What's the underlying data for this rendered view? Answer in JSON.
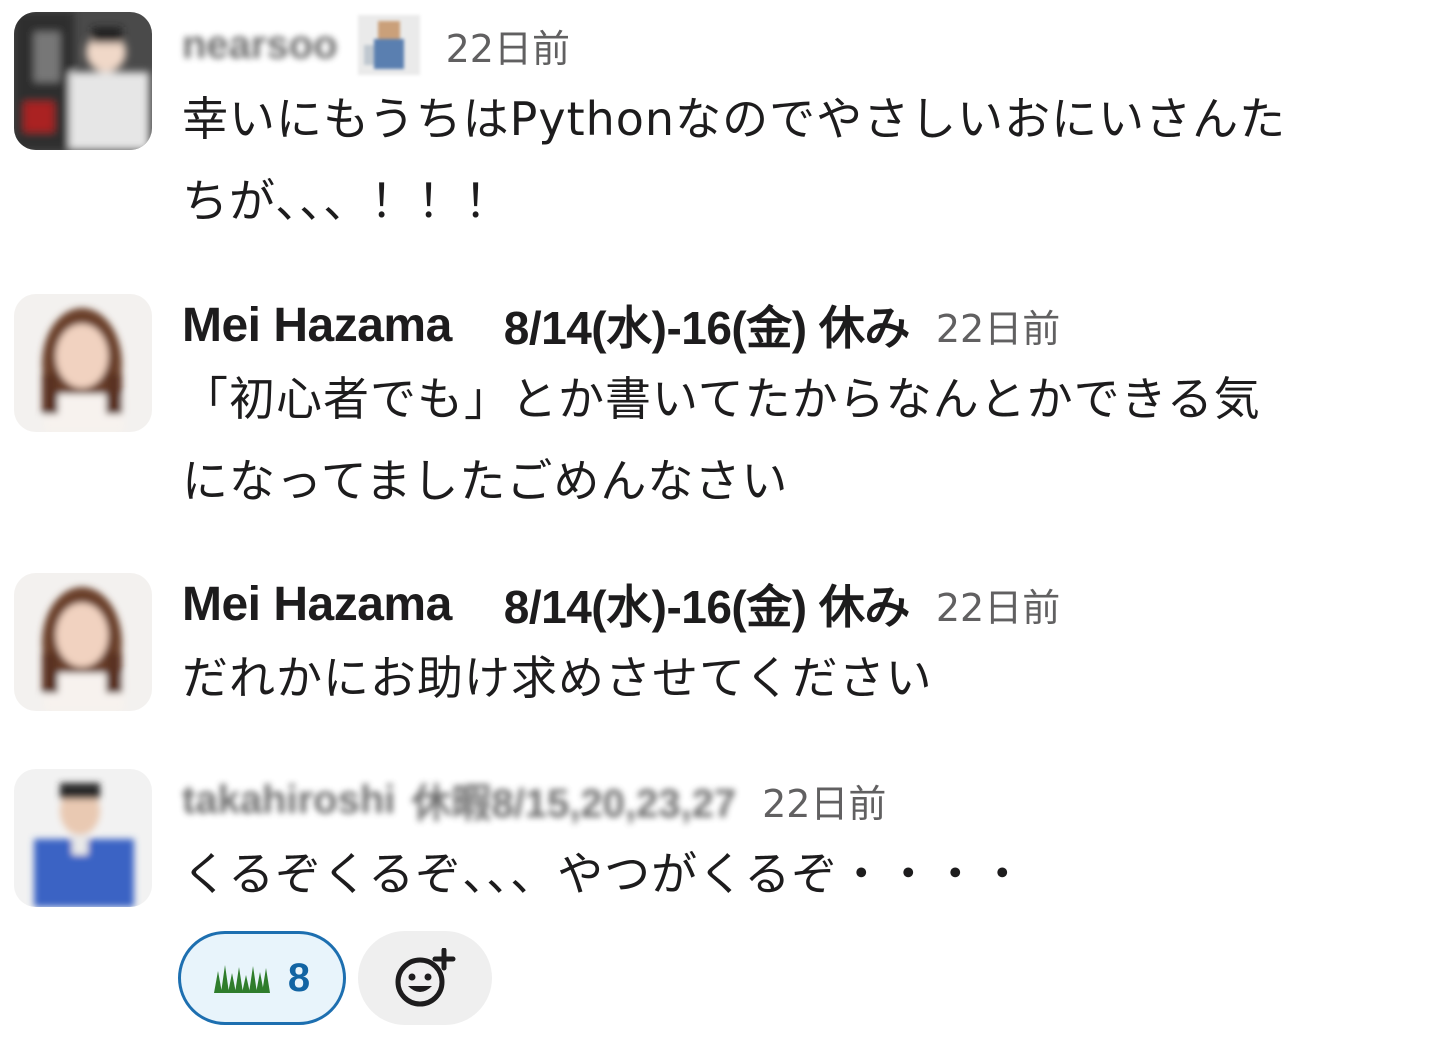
{
  "messages": [
    {
      "author": "nearsoo",
      "time": "22日前",
      "text": "幸いにもうちはPythonなのでやさしいおにいさんた\nちが、、、！！！"
    },
    {
      "author": "Mei Hazama",
      "status": "8/14(水)-16(金) 休み",
      "time": "22日前",
      "text": "「初心者でも」とか書いてたからなんとかできる気\nになってましたごめんなさい"
    },
    {
      "author": "Mei Hazama",
      "status": "8/14(水)-16(金) 休み",
      "time": "22日前",
      "text": "だれかにお助け求めさせてください"
    },
    {
      "author": "takahiroshi",
      "status": "休暇8/15,20,23,27",
      "time": "22日前",
      "text": "くるぞくるぞ、、、やつがくるぞ・・・・",
      "reactions": [
        {
          "emoji": "grass-emoji",
          "count": "8"
        }
      ],
      "add_reaction_icon": "add-reaction-icon"
    }
  ],
  "colors": {
    "accent": "#1264a3",
    "reaction_bg": "#e8f4fb",
    "grass": "#2f7d2c"
  }
}
